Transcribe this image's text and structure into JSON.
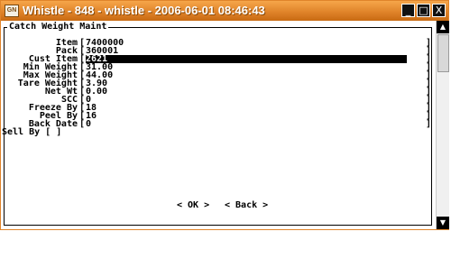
{
  "window": {
    "title": "Whistle - 848 - whistle - 2006-06-01 08:46:43",
    "app_icon_text": "GN",
    "minimize_label": "_",
    "maximize_label": "□",
    "close_label": "X",
    "accent_color": "#e0842a"
  },
  "screen": {
    "title": "Catch Weight Maint",
    "fields": [
      {
        "label": "Item",
        "value": "7400000"
      },
      {
        "label": "Pack",
        "value": "360001"
      },
      {
        "label": "Cust Item",
        "value": "2621"
      },
      {
        "label": "Min Weight",
        "value": "31.00"
      },
      {
        "label": "Max Weight",
        "value": "44.00"
      },
      {
        "label": "Tare Weight",
        "value": "3.90"
      },
      {
        "label": "Net Wt",
        "value": "0.00"
      },
      {
        "label": "SCC",
        "value": "0"
      },
      {
        "label": "Freeze By",
        "value": "18"
      },
      {
        "label": "Peel By",
        "value": "16"
      },
      {
        "label": "Back Date",
        "value": "0"
      }
    ],
    "sell_by": "Sell By [ ]",
    "ok_button": "<  OK  >",
    "back_button": "< Back >"
  },
  "scrollbar": {
    "up_icon": "up-arrow-icon",
    "down_icon": "down-arrow-icon"
  }
}
